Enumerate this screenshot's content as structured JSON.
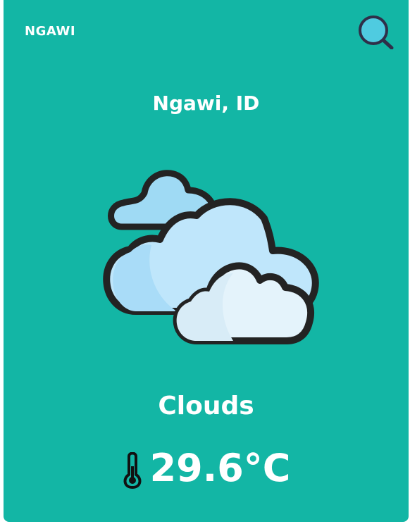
{
  "header": {
    "brand": "NGAWI",
    "search_icon": "search-icon"
  },
  "weather": {
    "location": "Ngawi, ID",
    "condition": "Clouds",
    "condition_icon": "clouds-icon",
    "temperature": "29.6°C",
    "temperature_icon": "thermometer-icon"
  },
  "colors": {
    "card_background": "#13b6a5",
    "search_icon_fill": "#4fcbe0",
    "outline": "#232323"
  }
}
